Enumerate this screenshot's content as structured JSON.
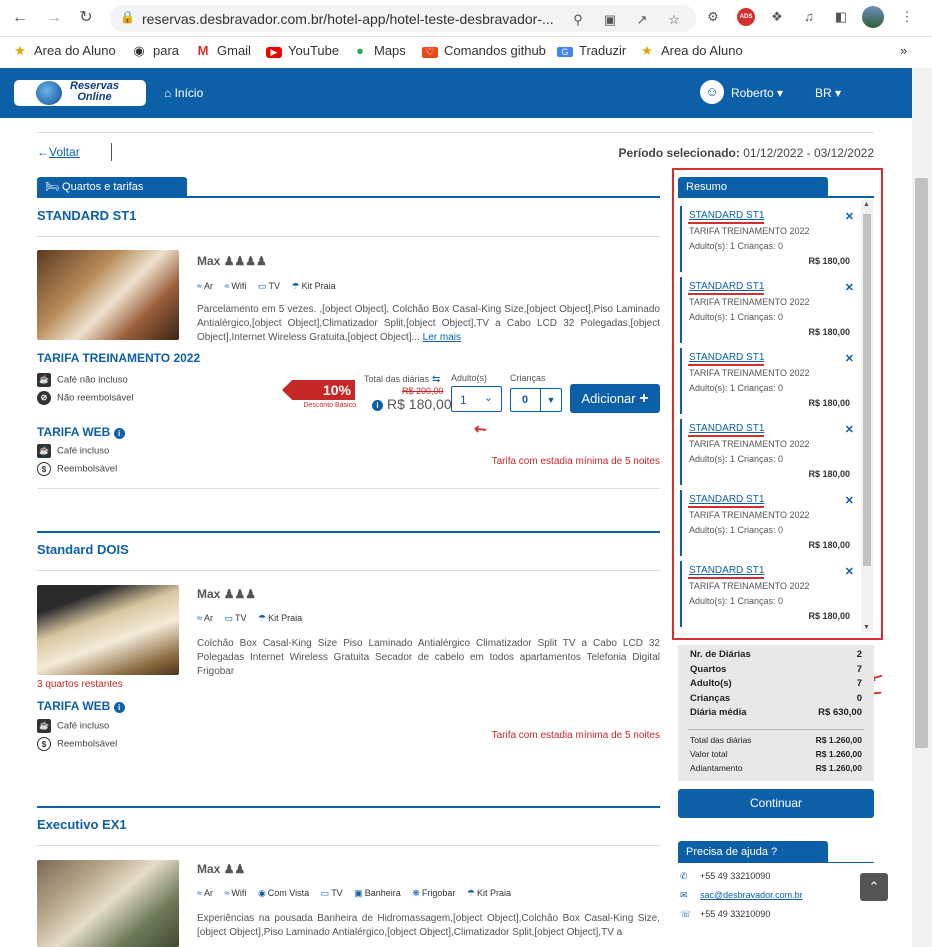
{
  "browser": {
    "url": "reservas.desbravador.com.br/hotel-app/hotel-teste-desbravador-...",
    "bookmarks": [
      {
        "label": "Area do Aluno",
        "icon": "star-icon"
      },
      {
        "label": "para",
        "icon": "globe-icon"
      },
      {
        "label": "Gmail",
        "icon": "gmail-icon"
      },
      {
        "label": "YouTube",
        "icon": "youtube-icon"
      },
      {
        "label": "Maps",
        "icon": "maps-icon"
      },
      {
        "label": "Comandos github",
        "icon": "heart-icon"
      },
      {
        "label": "Traduzir",
        "icon": "translate-icon"
      },
      {
        "label": "Area do Aluno",
        "icon": "star-icon"
      }
    ],
    "ext_badge": "ADS"
  },
  "header": {
    "logo_line1": "Reservas",
    "logo_line2": "Online",
    "home": "Início",
    "user": "Roberto",
    "lang": "BR"
  },
  "page": {
    "back": "Voltar",
    "period_label": "Período selecionado:",
    "period_value": "01/12/2022 - 03/12/2022",
    "rooms_tab": "Quartos e tarifas"
  },
  "rooms": [
    {
      "title": "STANDARD ST1",
      "max": "Max",
      "amenities": [
        "Ar",
        "Wifi",
        "TV",
        "Kit Praia"
      ],
      "description": "Parcelamento em 5 vezes. ,[object Object], Colchão Box Casal-King Size,[object Object],Piso Laminado Antialérgico,[object Object],Climatizador Split,[object Object],TV a Cabo LCD 32 Polegadas,[object Object],Internet Wireless Gratuita,[object Object]...",
      "read_more": "Ler mais",
      "rate1": {
        "name": "TARIFA TREINAMENTO 2022",
        "breakfast": "Café não incluso",
        "refund": "Não reembolsável",
        "discount": "10%",
        "discount_label": "Desconto Básico",
        "total_label": "Total das diárias",
        "old_price": "R$ 200,00",
        "price": "R$ 180,00",
        "adults_label": "Adulto(s)",
        "adults_value": "1",
        "children_label": "Crianças",
        "children_value": "0",
        "add_button": "Adicionar"
      },
      "rate2": {
        "name": "TARIFA WEB",
        "breakfast": "Café incluso",
        "refund": "Reembolsável",
        "min_stay": "Tarifa com estadia mínima de 5 noites"
      }
    },
    {
      "title": "Standard DOIS",
      "max": "Max",
      "amenities": [
        "Ar",
        "TV",
        "Kit Praia"
      ],
      "description": "Colchão Box Casal-King Size Piso Laminado Antialérgico Climatizador Split TV a Cabo LCD 32 Polegadas Internet Wireless Gratuita Secador de cabelo em todos apartamentos Telefonia Digital Frigobar",
      "remaining": "3 quartos restantes",
      "rate2": {
        "name": "TARIFA WEB",
        "breakfast": "Café incluso",
        "refund": "Reembolsável",
        "min_stay": "Tarifa com estadia mínima de 5 noites"
      }
    },
    {
      "title": "Executivo EX1",
      "max": "Max",
      "amenities": [
        "Ar",
        "Wifi",
        "Com Vista",
        "TV",
        "Banheira",
        "Frigobar",
        "Kit Praia"
      ],
      "description": "Experiências na pousada Banheira de Hidromassagem,[object Object],Colchão Box Casal-King Size,[object Object],Piso Laminado Antialérgico,[object Object],Climatizador Split,[object Object],TV a"
    }
  ],
  "summary": {
    "title": "Resumo",
    "items": [
      {
        "room": "STANDARD ST1",
        "rate": "TARIFA TREINAMENTO 2022",
        "people": "Adulto(s): 1 Crianças: 0",
        "price": "R$ 180,00"
      },
      {
        "room": "STANDARD ST1",
        "rate": "TARIFA TREINAMENTO 2022",
        "people": "Adulto(s): 1 Crianças: 0",
        "price": "R$ 180,00"
      },
      {
        "room": "STANDARD ST1",
        "rate": "TARIFA TREINAMENTO 2022",
        "people": "Adulto(s): 1 Crianças: 0",
        "price": "R$ 180,00"
      },
      {
        "room": "STANDARD ST1",
        "rate": "TARIFA TREINAMENTO 2022",
        "people": "Adulto(s): 1 Crianças: 0",
        "price": "R$ 180,00"
      },
      {
        "room": "STANDARD ST1",
        "rate": "TARIFA TREINAMENTO 2022",
        "people": "Adulto(s): 1 Crianças: 0",
        "price": "R$ 180,00"
      },
      {
        "room": "STANDARD ST1",
        "rate": "TARIFA TREINAMENTO 2022",
        "people": "Adulto(s): 1 Crianças: 0",
        "price": "R$ 180,00"
      }
    ],
    "stats": [
      {
        "k": "Nr. de Diárias",
        "v": "2"
      },
      {
        "k": "Quartos",
        "v": "7"
      },
      {
        "k": "Adulto(s)",
        "v": "7"
      },
      {
        "k": "Crianças",
        "v": "0"
      },
      {
        "k": "Diária média",
        "v": "R$ 630,00"
      }
    ],
    "totals": [
      {
        "k": "Total das diárias",
        "v": "R$ 1.260,00"
      },
      {
        "k": "Valor total",
        "v": "R$ 1.260,00"
      },
      {
        "k": "Adiantamento",
        "v": "R$ 1.260,00"
      }
    ],
    "continue": "Continuar"
  },
  "help": {
    "title": "Precisa de ajuda ?",
    "phone1": "+55 49 33210090",
    "email": "sac@desbravador.com.br",
    "phone2": "+55 49 33210090"
  },
  "colors": {
    "primary": "#0d5fa8",
    "alert": "#c62828",
    "annotation": "#d32f2f"
  }
}
